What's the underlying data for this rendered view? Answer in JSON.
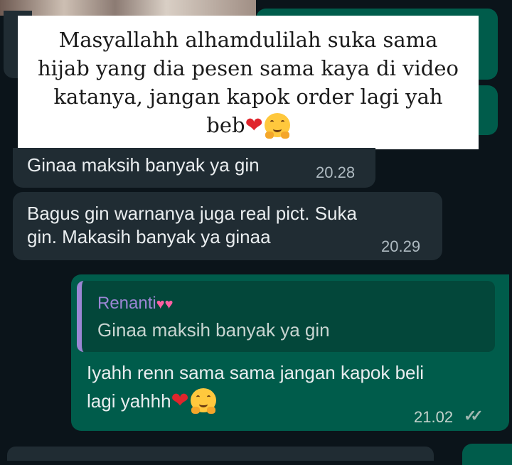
{
  "caption": {
    "lines": [
      "Masyallahh alhamdulilah suka sama",
      "hijab yang dia pesen sama kaya di video",
      "katanya, jangan kapok order lagi yah",
      "beb"
    ],
    "emoji_heart": "heart-emoji",
    "emoji_hug": "hugging-face-emoji"
  },
  "messages": [
    {
      "text": "Ginaa maksih banyak ya gin",
      "time": "20.28"
    },
    {
      "line1": "Bagus gin warnanya juga real pict. Suka",
      "line2": "gin. Makasih banyak ya ginaa",
      "time": "20.29"
    }
  ],
  "reply": {
    "quoted_name": "Renanti",
    "quoted_emoji": "two-hearts-emoji",
    "quoted_text": "Ginaa maksih banyak ya gin",
    "line1": "Iyahh renn sama sama jangan kapok beli",
    "line2": "lagi yahhh",
    "time": "21.02",
    "status_icon": "double-check-icon"
  },
  "colors": {
    "background": "#0b141a",
    "incoming_bubble": "#202c33",
    "outgoing_bubble": "#005c4b",
    "quote_bar": "#9b86d4"
  }
}
